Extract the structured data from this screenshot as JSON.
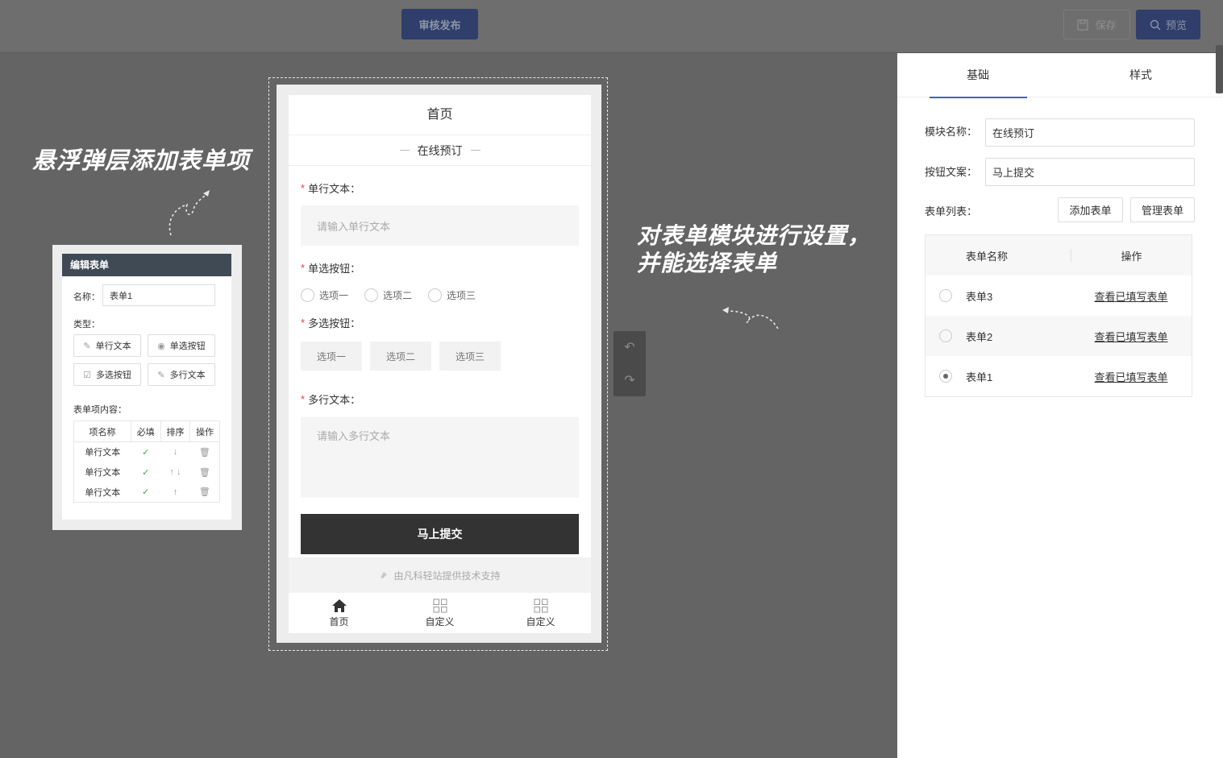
{
  "topbar": {
    "review_label": "审核发布",
    "save_label": "保存",
    "preview_label": "预览"
  },
  "annotations": {
    "left_note": "悬浮弹层添加表单项",
    "right_note_line1": "对表单模块进行设置，",
    "right_note_line2": "并能选择表单"
  },
  "phone": {
    "page_title": "首页",
    "module_title": "在线预订",
    "fields": {
      "single_text_label": "单行文本：",
      "single_text_placeholder": "请输入单行文本",
      "radio_label": "单选按钮：",
      "radio_options": [
        "选项一",
        "选项二",
        "选项三"
      ],
      "checkbox_label": "多选按钮：",
      "checkbox_options": [
        "选项一",
        "选项二",
        "选项三"
      ],
      "multi_text_label": "多行文本：",
      "multi_text_placeholder": "请输入多行文本",
      "required_mark": "*"
    },
    "submit_label": "马上提交",
    "support_text": "由凡科轻站提供技术支持",
    "tabbar": [
      {
        "label": "首页",
        "icon": "home-icon"
      },
      {
        "label": "自定义",
        "icon": "grid-icon"
      },
      {
        "label": "自定义",
        "icon": "grid-icon"
      }
    ]
  },
  "edit_form": {
    "title": "编辑表单",
    "name_label": "名称：",
    "name_value": "表单1",
    "type_label": "类型：",
    "types": [
      "单行文本",
      "单选按钮",
      "多选按钮",
      "多行文本"
    ],
    "content_label": "表单项内容：",
    "columns": [
      "项名称",
      "必填",
      "排序",
      "操作"
    ],
    "rows": [
      {
        "name": "单行文本",
        "sort": "↓"
      },
      {
        "name": "单行文本",
        "sort": "↑ ↓"
      },
      {
        "name": "单行文本",
        "sort": "↑"
      }
    ]
  },
  "settings": {
    "tabs": [
      "基础",
      "样式"
    ],
    "module_name_label": "模块名称：",
    "module_name_value": "在线预订",
    "button_text_label": "按钮文案：",
    "button_text_value": "马上提交",
    "form_list_label": "表单列表：",
    "add_form_label": "添加表单",
    "manage_form_label": "管理表单",
    "table_columns": [
      "表单名称",
      "操作"
    ],
    "forms": [
      {
        "name": "表单3",
        "action": "查看已填写表单",
        "selected": false
      },
      {
        "name": "表单2",
        "action": "查看已填写表单",
        "selected": false
      },
      {
        "name": "表单1",
        "action": "查看已填写表单",
        "selected": true
      }
    ]
  },
  "colors": {
    "accent": "#2f3e6a",
    "tab_underline": "#4a5fbd",
    "submit_bg": "#333333",
    "overlay_bg": "#646464"
  }
}
